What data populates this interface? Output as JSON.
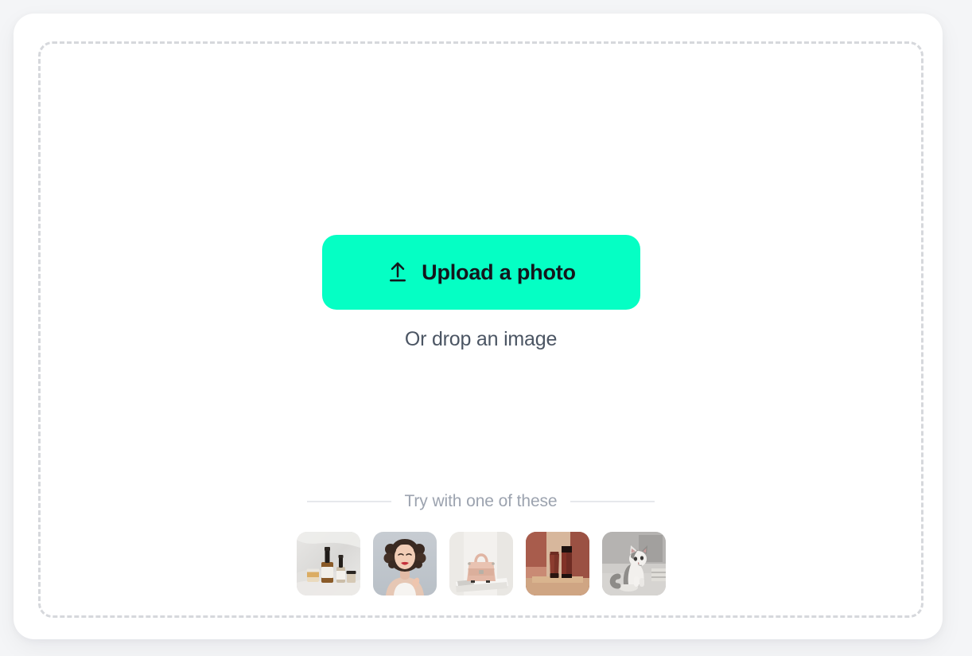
{
  "theme": {
    "page_background": "#f4f5f7",
    "card_background": "#ffffff",
    "accent": "#05FFC4",
    "dashed_border": "#d6d8dc",
    "muted_text": "#9ca3af",
    "body_text": "#4b5563",
    "button_text": "#14161c",
    "rule": "#e6e8ec"
  },
  "dropzone": {
    "upload_button": {
      "label": "Upload a photo",
      "icon": "upload-arrow-icon"
    },
    "drop_hint": "Or drop an image"
  },
  "samples": {
    "title": "Try with one of these",
    "items": [
      {
        "name": "skincare-bottles-thumbnail",
        "alt": "Serum and cosmetic bottles on light fabric"
      },
      {
        "name": "woman-portrait-thumbnail",
        "alt": "Smiling woman with curly dark hair and red lipstick"
      },
      {
        "name": "pink-handbag-thumbnail",
        "alt": "Blush pink handbag resting on a magazine"
      },
      {
        "name": "cosmetic-tubes-thumbnail",
        "alt": "Dark red cosmetic tube and bottle on terracotta backdrop"
      },
      {
        "name": "kitten-thumbnail",
        "alt": "Grey and white kitten sitting"
      }
    ]
  }
}
